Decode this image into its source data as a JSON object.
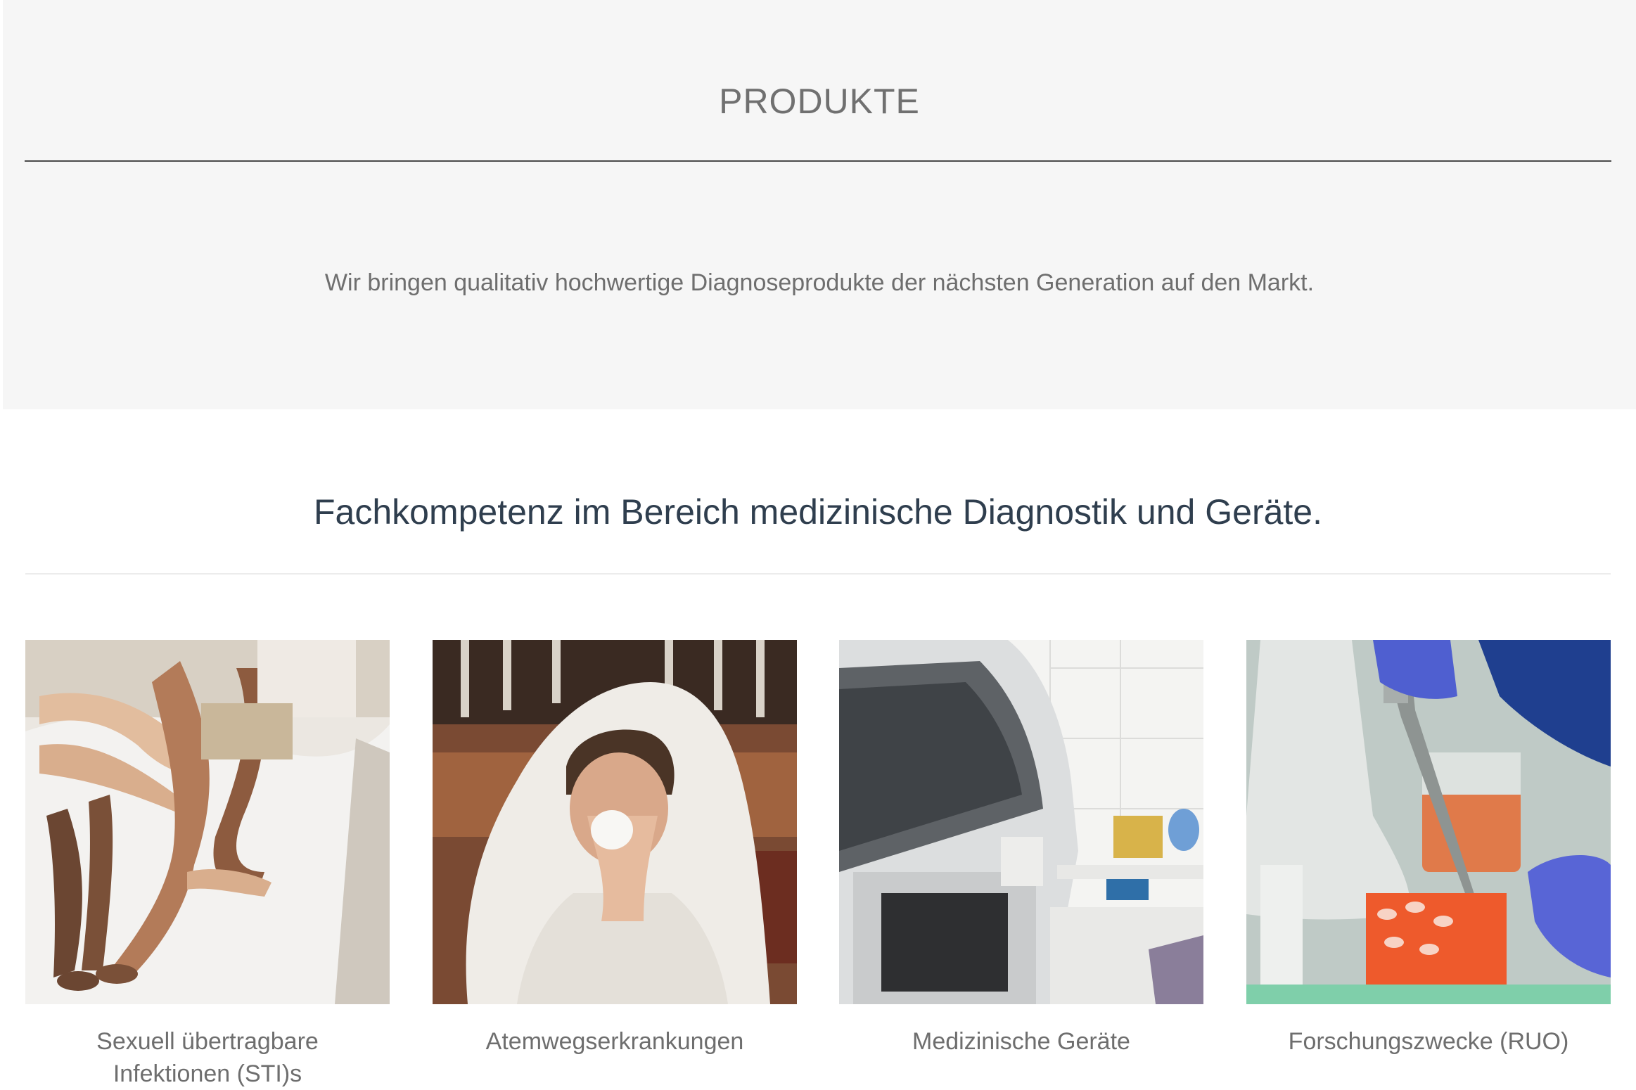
{
  "hero": {
    "title": "PRODUKTE",
    "subtitle": "Wir bringen qualitativ hochwertige Diagnoseprodukte der nächsten Generation auf den Markt."
  },
  "section": {
    "title": "Fachkompetenz im Bereich medizinische Diagnostik und Geräte."
  },
  "cards": [
    {
      "label": "Sexuell übertragbare\nInfektionen (STI)s",
      "image": "couple-on-bed-photo"
    },
    {
      "label": "Atemwegserkrankungen",
      "image": "man-sneezing-blanket-photo"
    },
    {
      "label": "Medizinische Geräte",
      "image": "lab-analyzer-machine-photo"
    },
    {
      "label": "Forschungszwecke (RUO)",
      "image": "pipette-lab-photo"
    }
  ]
}
